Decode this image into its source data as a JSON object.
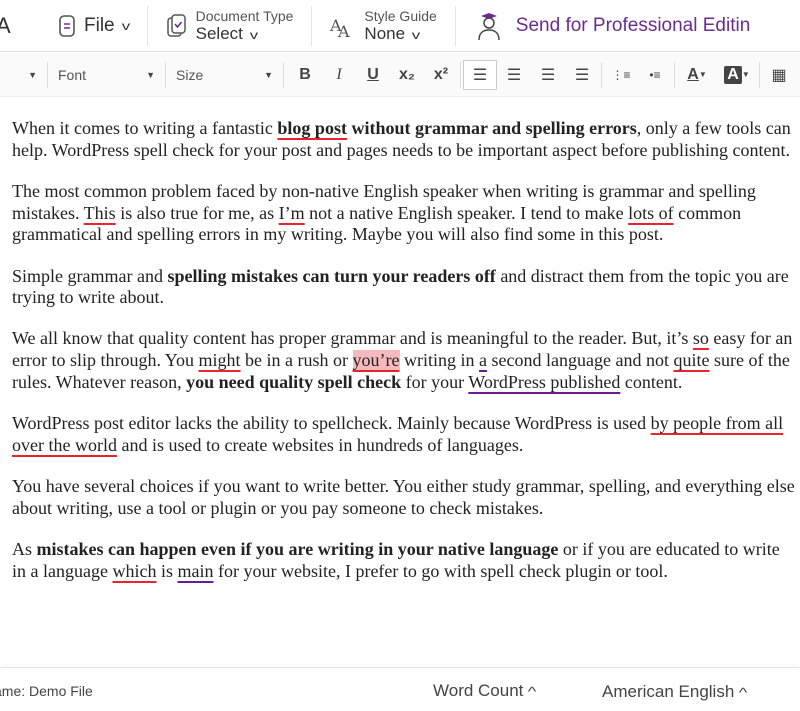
{
  "topbar": {
    "logo_fragment": "A",
    "file_label": "File",
    "doc_type_label": "Document Type",
    "doc_type_value": "Select",
    "style_guide_label": "Style Guide",
    "style_guide_value": "None",
    "send_label": "Send for Professional Editin"
  },
  "format_bar": {
    "font_label": "Font",
    "size_label": "Size",
    "bold": "B",
    "italic": "I",
    "underline": "U",
    "subscript": "x₂",
    "superscript": "x²",
    "font_color": "A",
    "highlight": "A"
  },
  "document": {
    "paragraphs": [
      [
        {
          "t": "When it comes to writing a fantastic ",
          "s": ""
        },
        {
          "t": "blog post",
          "s": "b r"
        },
        {
          "t": " without grammar and spelling errors",
          "s": "b"
        },
        {
          "t": ", only a few tools can help. WordPress spell check for your post and pages needs to be important aspect before publishing content.",
          "s": ""
        }
      ],
      [
        {
          "t": "The most common problem faced by non-native English speaker when writing is grammar and spelling mistakes. ",
          "s": ""
        },
        {
          "t": "This",
          "s": "r"
        },
        {
          "t": " is also true for me, as ",
          "s": ""
        },
        {
          "t": "I’m",
          "s": "r"
        },
        {
          "t": " not a native English speaker. I tend to make ",
          "s": ""
        },
        {
          "t": "lots of",
          "s": "r"
        },
        {
          "t": " common grammatical and spelling errors in my writing. Maybe you will also find some in this post.",
          "s": ""
        }
      ],
      [
        {
          "t": "Simple grammar and ",
          "s": ""
        },
        {
          "t": "spelling mistakes can turn your readers off",
          "s": "b"
        },
        {
          "t": " and distract them from the topic you are trying to write about.",
          "s": ""
        }
      ],
      [
        {
          "t": "We all know that quality content has proper grammar and is meaningful to the reader. But, it’s ",
          "s": ""
        },
        {
          "t": "so",
          "s": "r"
        },
        {
          "t": " easy for an error to slip through. You ",
          "s": ""
        },
        {
          "t": "might",
          "s": "r"
        },
        {
          "t": " be in a rush or ",
          "s": ""
        },
        {
          "t": "you’re",
          "s": "h"
        },
        {
          "t": " writing in ",
          "s": ""
        },
        {
          "t": "a",
          "s": "p"
        },
        {
          "t": " second language and not ",
          "s": ""
        },
        {
          "t": "quite",
          "s": "r"
        },
        {
          "t": " sure of the rules. Whatever reason, ",
          "s": ""
        },
        {
          "t": "you need quality spell check",
          "s": "b"
        },
        {
          "t": " for your ",
          "s": ""
        },
        {
          "t": "WordPress published",
          "s": "p"
        },
        {
          "t": " content.",
          "s": ""
        }
      ],
      [
        {
          "t": "WordPress post editor lacks the ability to spellcheck. Mainly because WordPress is used ",
          "s": ""
        },
        {
          "t": "by people from all over the world",
          "s": "r"
        },
        {
          "t": " and is used to create websites in hundreds of languages.",
          "s": ""
        }
      ],
      [
        {
          "t": "You have several choices if you want to write better. You either study grammar, spelling, and everything else about writing, use a tool or plugin or you pay someone to check mistakes.",
          "s": ""
        }
      ],
      [
        {
          "t": "As ",
          "s": ""
        },
        {
          "t": "mistakes can happen even if you are writing in your native language",
          "s": "b"
        },
        {
          "t": " or if you are educated to write in a language ",
          "s": ""
        },
        {
          "t": "which",
          "s": "r"
        },
        {
          "t": " is ",
          "s": ""
        },
        {
          "t": "main",
          "s": "p"
        },
        {
          "t": " for your website, I prefer to go with spell check plugin or tool.",
          "s": ""
        }
      ]
    ]
  },
  "footer": {
    "file_name": "ame:  Demo File",
    "word_count": "Word Count",
    "language": "American English"
  },
  "colors": {
    "accent": "#6a2c91",
    "spelling": "#e8242e",
    "grammar": "#6a1b9a"
  }
}
